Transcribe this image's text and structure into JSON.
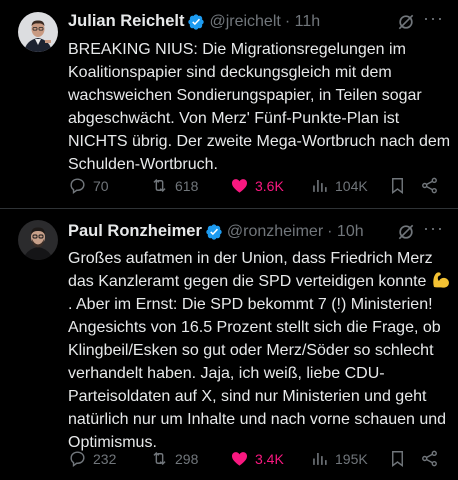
{
  "tweets": [
    {
      "author_name": "Julian Reichelt",
      "handle": "@jreichelt",
      "time": "· 11h",
      "text": "BREAKING NIUS: Die Migrationsregelungen im Koalitionspapier sind deckungsgleich mit dem wachsweichen Sondierungspapier, in Teilen sogar abgeschwächt. Von Merz' Fünf-Punkte-Plan ist NICHTS übrig. Der zweite Mega-Wortbruch nach dem Schulden-Wortbruch.",
      "replies": "70",
      "reposts": "618",
      "likes": "3.6K",
      "views": "104K"
    },
    {
      "author_name": "Paul Ronzheimer",
      "handle": "@ronzheimer",
      "time": "· 10h",
      "text_part1": "Großes aufatmen in der Union, dass Friedrich Merz das Kanzleramt gegen die SPD verteidigen konnte ",
      "text_part2": ". Aber im Ernst: Die SPD bekommt 7 (!) Ministerien! Angesichts von 16.5 Prozent stellt sich die Frage, ob Klingbeil/Esken so gut oder Merz/Söder so schlecht verhandelt haben. Jaja, ich weiß, liebe CDU-Parteisoldaten auf X, sind nur Ministerien und geht natürlich nur um Inhalte und nach vorne schauen und Optimismus.",
      "replies": "232",
      "reposts": "298",
      "likes": "3.4K",
      "views": "195K"
    }
  ],
  "more_label": "···",
  "colors": {
    "background": "#000000",
    "text": "#e7e9ea",
    "muted": "#71767b",
    "like": "#f91880",
    "verified": "#1d9bf0"
  },
  "icons": [
    "verified-badge-icon",
    "grok-icon",
    "more-icon",
    "reply-icon",
    "repost-icon",
    "like-icon",
    "views-icon",
    "bookmark-icon",
    "share-icon",
    "flexed-biceps-emoji"
  ]
}
